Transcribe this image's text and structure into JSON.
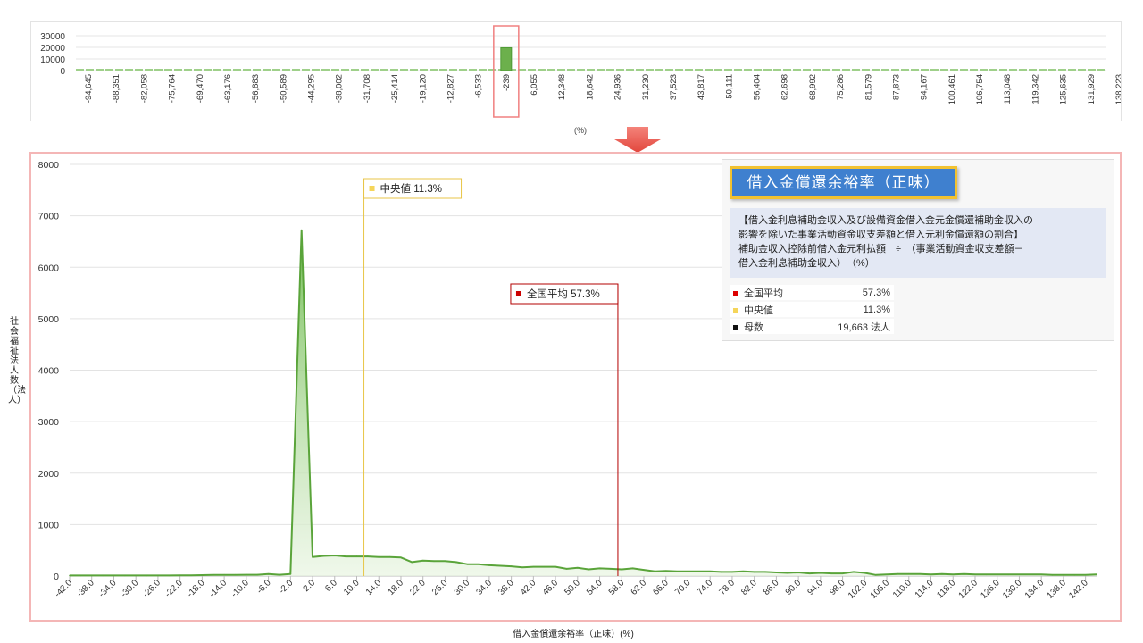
{
  "overview": {
    "yticks": [
      "30000",
      "20000",
      "10000",
      "0"
    ],
    "xticks": [
      "-94,645",
      "-88,351",
      "-82,058",
      "-75,764",
      "-69,470",
      "-63,176",
      "-56,883",
      "-50,589",
      "-44,295",
      "-38,002",
      "-31,708",
      "-25,414",
      "-19,120",
      "-12,827",
      "-6,533",
      "-239",
      "6,055",
      "12,348",
      "18,642",
      "24,936",
      "31,230",
      "37,523",
      "43,817",
      "50,111",
      "56,404",
      "62,698",
      "68,992",
      "75,286",
      "81,579",
      "87,873",
      "94,167",
      "100,461",
      "106,754",
      "113,048",
      "119,342",
      "125,635",
      "131,929",
      "138,223"
    ],
    "unit": "(%)",
    "highlight_tick": "-239",
    "max_value": 30000,
    "peak_value": 19663
  },
  "chart_data": {
    "type": "area",
    "title": "",
    "xlabel": "借入金償還余裕率（正味）(%)",
    "ylabel": "社会福祉法人数（法人）",
    "ylim": [
      0,
      8000
    ],
    "xlim": [
      -42,
      144
    ],
    "grid": true,
    "ytick_labels": [
      "8000",
      "7000",
      "6000",
      "5000",
      "4000",
      "3000",
      "2000",
      "1000",
      "0"
    ],
    "xtick_labels": [
      "-42.0",
      "-38.0",
      "-34.0",
      "-30.0",
      "-26.0",
      "-22.0",
      "-18.0",
      "-14.0",
      "-10.0",
      "-6.0",
      "-2.0",
      "2.0",
      "6.0",
      "10.0",
      "14.0",
      "18.0",
      "22.0",
      "26.0",
      "30.0",
      "34.0",
      "38.0",
      "42.0",
      "46.0",
      "50.0",
      "54.0",
      "58.0",
      "62.0",
      "66.0",
      "70.0",
      "74.0",
      "78.0",
      "82.0",
      "86.0",
      "90.0",
      "94.0",
      "98.0",
      "102.0",
      "106.0",
      "110.0",
      "114.0",
      "118.0",
      "122.0",
      "126.0",
      "130.0",
      "134.0",
      "138.0",
      "142.0"
    ],
    "x": [
      -42,
      -40,
      -38,
      -36,
      -34,
      -32,
      -30,
      -28,
      -26,
      -24,
      -22,
      -20,
      -18,
      -16,
      -14,
      -12,
      -10,
      -8,
      -6,
      -4,
      -2,
      0,
      2,
      4,
      6,
      8,
      10,
      12,
      14,
      16,
      18,
      20,
      22,
      24,
      26,
      28,
      30,
      32,
      34,
      36,
      38,
      40,
      42,
      44,
      46,
      48,
      50,
      52,
      54,
      56,
      58,
      60,
      62,
      64,
      66,
      68,
      70,
      72,
      74,
      76,
      78,
      80,
      82,
      84,
      86,
      88,
      90,
      92,
      94,
      96,
      98,
      100,
      102,
      104,
      106,
      108,
      110,
      112,
      114,
      116,
      118,
      120,
      122,
      124,
      126,
      128,
      130,
      132,
      134,
      136,
      138,
      140,
      142,
      144
    ],
    "values": [
      10,
      10,
      10,
      10,
      10,
      10,
      10,
      10,
      10,
      10,
      12,
      12,
      18,
      20,
      22,
      22,
      25,
      25,
      40,
      25,
      40,
      6720,
      370,
      390,
      400,
      380,
      380,
      380,
      370,
      370,
      360,
      270,
      300,
      290,
      290,
      270,
      230,
      230,
      210,
      200,
      190,
      170,
      180,
      180,
      180,
      140,
      160,
      130,
      150,
      140,
      130,
      150,
      120,
      90,
      100,
      90,
      90,
      90,
      90,
      80,
      80,
      90,
      80,
      80,
      70,
      60,
      70,
      50,
      60,
      50,
      50,
      80,
      60,
      20,
      30,
      40,
      40,
      40,
      30,
      40,
      30,
      40,
      30,
      30,
      30,
      30,
      30,
      30,
      30,
      20,
      20,
      20,
      20,
      30
    ],
    "markers": [
      {
        "label": "中央値",
        "value": "11.3%",
        "x": 11.3,
        "color": "#f5d55a",
        "border": "#e8c547"
      },
      {
        "label": "全国平均",
        "value": "57.3%",
        "x": 57.3,
        "color": "#cc0000",
        "border": "#b30000"
      }
    ]
  },
  "info": {
    "title": "借入金償還余裕率（正味）",
    "desc_lines": [
      "【借入金利息補助金収入及び設備資金借入金元金償還補助金収入の",
      "影響を除いた事業活動資金収支差額と借入元利金償還額の割合】",
      "補助金収入控除前借入金元利払額　÷　（事業活動資金収支差額－",
      "借入金利息補助金収入）　（%）"
    ],
    "rows": [
      {
        "label": "全国平均",
        "value": "57.3%",
        "color": "#dd0000"
      },
      {
        "label": "中央値",
        "value": "11.3%",
        "color": "#f5d55a"
      },
      {
        "label": "母数",
        "value": "19,663  法人",
        "color": "#111111"
      }
    ]
  }
}
